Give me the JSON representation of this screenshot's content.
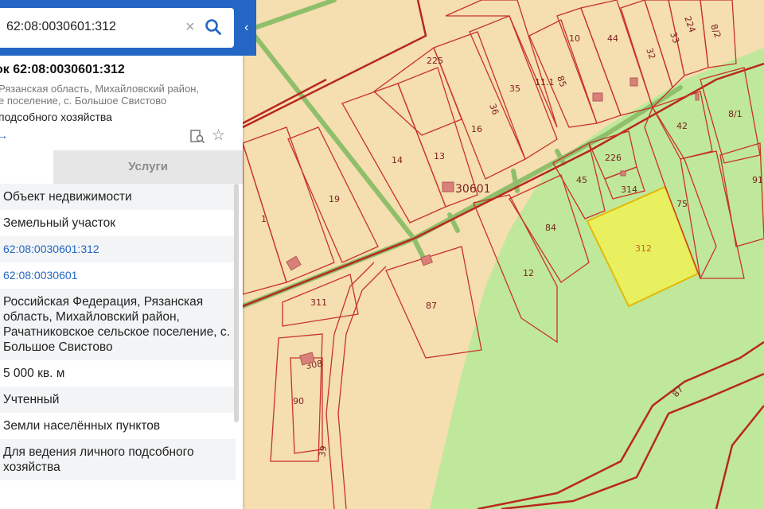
{
  "search": {
    "value": "62:08:0030601:312",
    "clear_icon": "close-icon",
    "search_icon": "search-icon"
  },
  "panel": {
    "title": "ок 62:08:0030601:312",
    "address_line1": "Рязанская область, Михайловский район,",
    "address_line2": "е поселение, с. Большое Свистово",
    "use": "подсобного хозяйства",
    "more_link": "→",
    "tabs": {
      "info": "",
      "services": "Услуги"
    },
    "rows": [
      {
        "text": "Объект недвижимости",
        "kind": "alt"
      },
      {
        "text": "Земельный участок",
        "kind": ""
      },
      {
        "text": "62:08:0030601:312",
        "kind": "alt link"
      },
      {
        "text": "62:08:0030601",
        "kind": "link"
      },
      {
        "text": "Российская Федерация, Рязанская область, Михайловский район, Рачатниковское сельское поселение, с. Большое Свистово",
        "kind": "alt"
      },
      {
        "text": "5 000 кв. м",
        "kind": ""
      },
      {
        "text": "Учтенный",
        "kind": "alt"
      },
      {
        "text": "Земли населённых пунктов",
        "kind": ""
      },
      {
        "text": "Для ведения личного подсобного хозяйства",
        "kind": "alt"
      }
    ]
  },
  "map": {
    "quarter_label": "30601",
    "selected_parcel": "312",
    "parcel_labels": [
      "225",
      "10",
      "44",
      "32",
      "33",
      "224",
      "8/2",
      "35",
      "11.1",
      "85",
      "36",
      "16",
      "13",
      "14",
      "19",
      "1",
      "42",
      "8/1",
      "226",
      "45",
      "314",
      "75",
      "91",
      "84",
      "12",
      "311",
      "87",
      "308",
      "90",
      "39",
      "87"
    ],
    "colors": {
      "base": "#f5deb0",
      "forest": "#bfe89a",
      "selected": "#e8f060",
      "boundary": "#c8322a",
      "road": "#8fbf6a"
    }
  }
}
